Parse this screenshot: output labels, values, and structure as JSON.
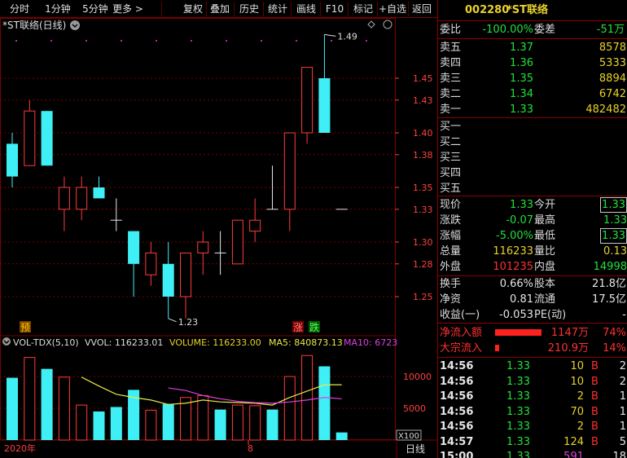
{
  "toolbar": {
    "items": [
      "分时",
      "1分钟",
      "5分钟",
      "更多 >",
      "复权",
      "叠加",
      "历史",
      "统计",
      "画线",
      "F10",
      "标记",
      "+自选",
      "返回"
    ]
  },
  "chart": {
    "title": "*ST联络(日线)",
    "price_ticks": [
      "1.45",
      "1.43",
      "1.40",
      "1.38",
      "1.35",
      "1.33",
      "1.30",
      "1.28",
      "1.25"
    ],
    "high_label": "1.49",
    "low_label": "1.23",
    "marker_left": "预",
    "marker_zhang": "涨",
    "marker_die": "跌",
    "vol_header": {
      "name": "VOL-TDX(5,10)",
      "vvol": "VVOL: 116233.01",
      "volume": "VOLUME: 116233.00",
      "ma5": "MA5: 840873.13",
      "ma10": "MA10: 6723"
    },
    "vol_ticks": [
      "10000",
      "5000"
    ],
    "vol_unit": "X100",
    "date_left": "2020年",
    "date_mid": "8",
    "period": "日线",
    "colors": {
      "up": "#ff3b3b",
      "down": "#3ef0f5",
      "ma5": "#e8e84a",
      "ma10": "#e040e0",
      "grid": "#7a0000"
    }
  },
  "chart_data": {
    "type": "candlestick",
    "candles": [
      {
        "o": 1.36,
        "c": 1.39,
        "h": 1.4,
        "l": 1.35,
        "dir": "down"
      },
      {
        "o": 1.37,
        "c": 1.42,
        "h": 1.43,
        "l": 1.37,
        "dir": "up"
      },
      {
        "o": 1.42,
        "c": 1.37,
        "h": 1.42,
        "l": 1.37,
        "dir": "down"
      },
      {
        "o": 1.33,
        "c": 1.35,
        "h": 1.36,
        "l": 1.31,
        "dir": "up"
      },
      {
        "o": 1.33,
        "c": 1.35,
        "h": 1.36,
        "l": 1.32,
        "dir": "up"
      },
      {
        "o": 1.35,
        "c": 1.34,
        "h": 1.36,
        "l": 1.34,
        "dir": "down"
      },
      {
        "o": 1.32,
        "c": 1.32,
        "h": 1.34,
        "l": 1.31,
        "dir": "flat"
      },
      {
        "o": 1.31,
        "c": 1.28,
        "h": 1.31,
        "l": 1.25,
        "dir": "down"
      },
      {
        "o": 1.27,
        "c": 1.29,
        "h": 1.3,
        "l": 1.26,
        "dir": "up"
      },
      {
        "o": 1.28,
        "c": 1.25,
        "h": 1.3,
        "l": 1.23,
        "dir": "down"
      },
      {
        "o": 1.25,
        "c": 1.29,
        "h": 1.29,
        "l": 1.23,
        "dir": "up"
      },
      {
        "o": 1.29,
        "c": 1.3,
        "h": 1.31,
        "l": 1.27,
        "dir": "up"
      },
      {
        "o": 1.29,
        "c": 1.29,
        "h": 1.31,
        "l": 1.27,
        "dir": "flat"
      },
      {
        "o": 1.28,
        "c": 1.32,
        "h": 1.32,
        "l": 1.28,
        "dir": "up"
      },
      {
        "o": 1.31,
        "c": 1.32,
        "h": 1.34,
        "l": 1.3,
        "dir": "up"
      },
      {
        "o": 1.33,
        "c": 1.33,
        "h": 1.37,
        "l": 1.33,
        "dir": "flat"
      },
      {
        "o": 1.33,
        "c": 1.4,
        "h": 1.4,
        "l": 1.31,
        "dir": "up"
      },
      {
        "o": 1.4,
        "c": 1.46,
        "h": 1.46,
        "l": 1.39,
        "dir": "up"
      },
      {
        "o": 1.45,
        "c": 1.4,
        "h": 1.49,
        "l": 1.4,
        "dir": "down"
      },
      {
        "o": 1.33,
        "c": 1.33,
        "h": 1.33,
        "l": 1.33,
        "dir": "flat"
      }
    ],
    "volumes": [
      9800,
      13000,
      11200,
      9900,
      5500,
      4500,
      5200,
      7900,
      4700,
      5700,
      6700,
      7000,
      4800,
      5500,
      5400,
      4800,
      10000,
      13300,
      11600,
      1200
    ],
    "ma5": [
      null,
      null,
      null,
      null,
      9900,
      8500,
      7200,
      6700,
      6300,
      5600,
      5800,
      6300,
      6000,
      5900,
      5800,
      5500,
      6700,
      7700,
      8700,
      8700
    ],
    "ma10": [
      null,
      null,
      null,
      null,
      null,
      null,
      null,
      null,
      null,
      8200,
      7800,
      7000,
      6500,
      6100,
      5900,
      5800,
      6000,
      6300,
      6700,
      6500
    ]
  },
  "panel": {
    "code": "002280",
    "name": "*ST联络",
    "weibi_label": "委比",
    "weibi": "-100.00%",
    "weicha_label": "委差",
    "weicha": "-51万",
    "sell": [
      {
        "label": "卖五",
        "price": "1.37",
        "vol": "8578"
      },
      {
        "label": "卖四",
        "price": "1.36",
        "vol": "5333"
      },
      {
        "label": "卖三",
        "price": "1.35",
        "vol": "8894"
      },
      {
        "label": "卖二",
        "price": "1.34",
        "vol": "6742"
      },
      {
        "label": "卖一",
        "price": "1.33",
        "vol": "482482"
      }
    ],
    "buy": [
      {
        "label": "买一"
      },
      {
        "label": "买二"
      },
      {
        "label": "买三"
      },
      {
        "label": "买四"
      },
      {
        "label": "买五"
      }
    ],
    "stats": [
      {
        "l1": "现价",
        "v1": "1.33",
        "l2": "今开",
        "v2": "1.33",
        "c1": "g",
        "c2": "g",
        "box2": true
      },
      {
        "l1": "涨跌",
        "v1": "-0.07",
        "l2": "最高",
        "v2": "1.33",
        "c1": "g",
        "c2": "g",
        "box2": false
      },
      {
        "l1": "涨幅",
        "v1": "-5.00%",
        "l2": "最低",
        "v2": "1.33",
        "c1": "g",
        "c2": "g",
        "box2": true
      },
      {
        "l1": "总量",
        "v1": "116233",
        "l2": "量比",
        "v2": "0.13",
        "c1": "y",
        "c2": "y",
        "box2": false
      },
      {
        "l1": "外盘",
        "v1": "101235",
        "l2": "内盘",
        "v2": "14998",
        "c1": "r",
        "c2": "g",
        "box2": false
      }
    ],
    "fin": [
      {
        "l1": "换手",
        "v1": "0.66%",
        "l2": "股本",
        "v2": "21.8亿"
      },
      {
        "l1": "净资",
        "v1": "0.81",
        "l2": "流通",
        "v2": "17.5亿"
      },
      {
        "l1": "收益(一)",
        "v1": "-0.053",
        "l2": "PE(动)",
        "v2": "-"
      }
    ],
    "flow": [
      {
        "label": "净流入额",
        "amount": "1147万",
        "pct": "74%",
        "bar": 0.92
      },
      {
        "label": "大宗流入",
        "amount": "210.9万",
        "pct": "14%",
        "bar": 0.05
      }
    ],
    "ticks": [
      {
        "t": "14:56",
        "p": "1.33",
        "v": "10",
        "s": "B",
        "n": "2"
      },
      {
        "t": "14:56",
        "p": "1.33",
        "v": "10",
        "s": "B",
        "n": "2"
      },
      {
        "t": "14:56",
        "p": "1.33",
        "v": "2",
        "s": "B",
        "n": "1"
      },
      {
        "t": "14:56",
        "p": "1.33",
        "v": "70",
        "s": "B",
        "n": "1"
      },
      {
        "t": "14:56",
        "p": "1.33",
        "v": "2",
        "s": "B",
        "n": "1"
      },
      {
        "t": "14:57",
        "p": "1.33",
        "v": "124",
        "s": "B",
        "n": "5"
      },
      {
        "t": "15:00",
        "p": "1.33",
        "v": "591",
        "s": "",
        "n": "18"
      }
    ]
  }
}
